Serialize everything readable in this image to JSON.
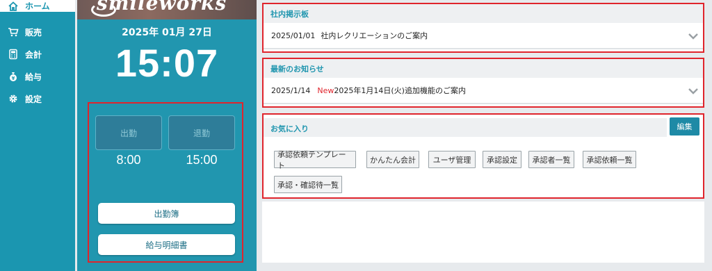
{
  "nav": {
    "items": [
      {
        "label": "ホーム",
        "icon": "home-icon"
      },
      {
        "label": "販売",
        "icon": "cart-icon"
      },
      {
        "label": "会計",
        "icon": "calculator-icon"
      },
      {
        "label": "給与",
        "icon": "money-bag-icon"
      },
      {
        "label": "設定",
        "icon": "gear-icon"
      }
    ]
  },
  "center": {
    "banner_logo": "smileworks",
    "date": "2025年 01月 27日",
    "clock": "15:07",
    "clock_in_label": "出勤",
    "clock_out_label": "退勤",
    "clock_in_time": "8:00",
    "clock_out_time": "15:00",
    "attendance_button": "出勤簿",
    "payslip_button": "給与明細書"
  },
  "board": {
    "title": "社内掲示板",
    "date": "2025/01/01",
    "text": "社内レクリエーションのご案内"
  },
  "news": {
    "title": "最新のお知らせ",
    "date": "2025/1/14",
    "badge": "New",
    "text": "2025年1月14日(火)追加機能のご案内"
  },
  "favorites": {
    "title": "お気に入り",
    "edit_label": "編集",
    "chips": [
      "承認依頼テンプレート",
      "かんたん会計",
      "ユーザ管理",
      "承認設定",
      "承認者一覧",
      "承認依頼一覧",
      "承認・確認待一覧"
    ]
  },
  "colors": {
    "accent": "#1b96b0",
    "highlight_border": "#e0242c",
    "new_badge": "#e0242c"
  }
}
